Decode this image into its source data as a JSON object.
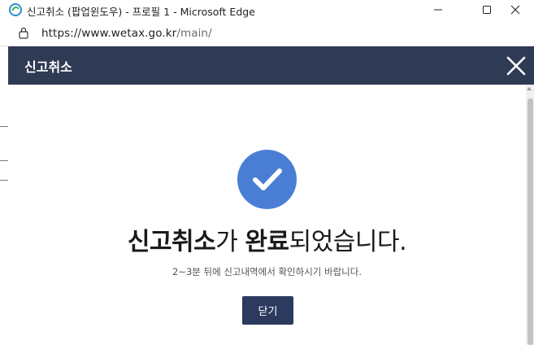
{
  "window": {
    "title": "신고취소 (팝업윈도우) - 프로필 1 - Microsoft Edge",
    "icons": {
      "app": "edge-icon",
      "minimize": "minimize-icon",
      "maximize": "maximize-icon",
      "close": "window-close-icon"
    }
  },
  "addressbar": {
    "url_host": "https://www.wetax.go.kr",
    "url_path": "/main/",
    "lock_icon": "lock-icon"
  },
  "modal": {
    "title": "신고취소",
    "close_icon": "close-icon",
    "check_icon": "check-circle-icon",
    "message_part1_bold": "신고취소",
    "message_part2": "가 ",
    "message_part3_bold": "완료",
    "message_part4": "되었습니다.",
    "sub_message": "2~3분 뒤에 신고내역에서 확인하시기 바랍니다.",
    "close_button": "닫기"
  },
  "colors": {
    "header_bg": "#2f3a54",
    "check_circle": "#4a7ed4",
    "button_bg": "#2c3a5f"
  }
}
